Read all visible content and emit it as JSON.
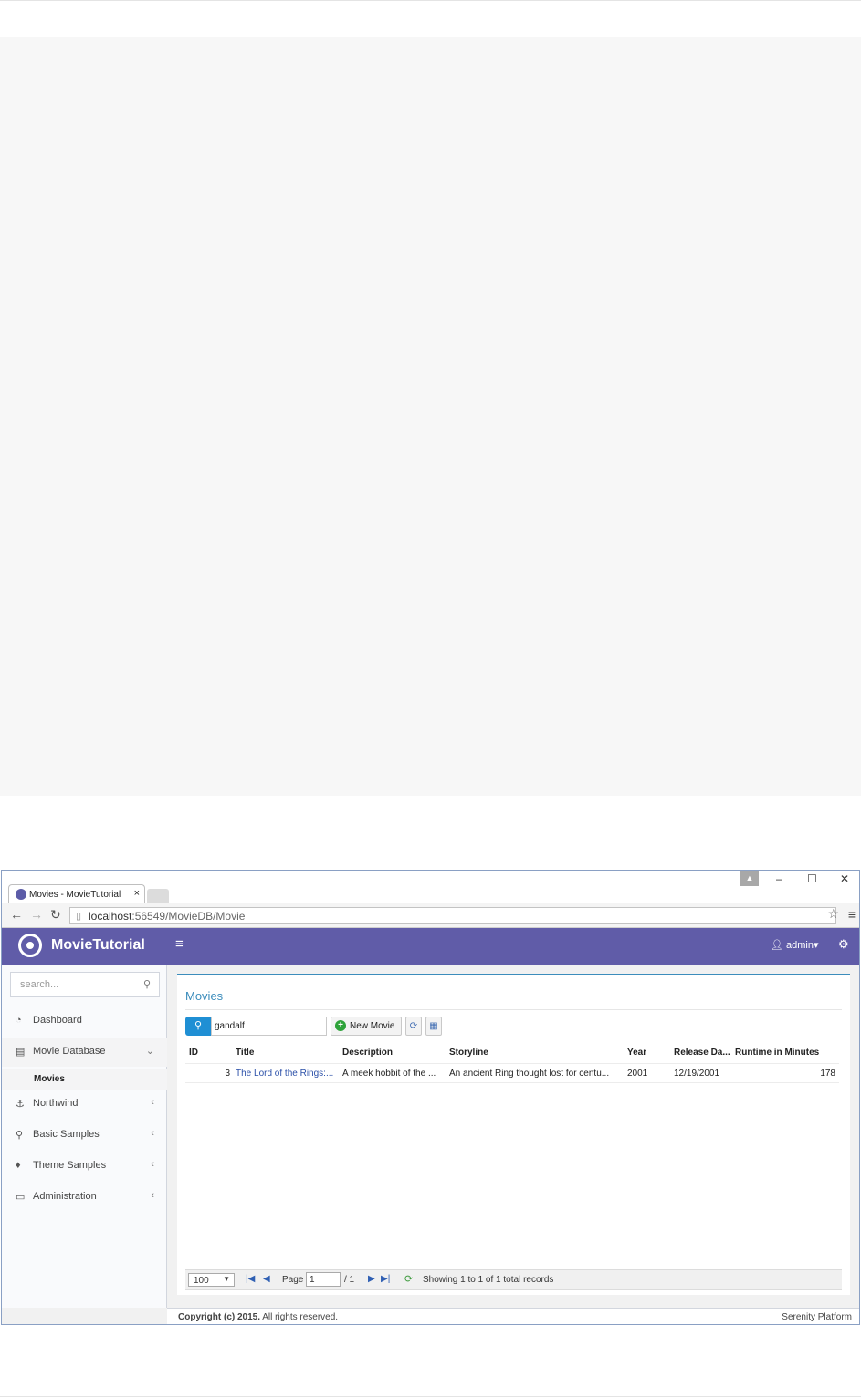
{
  "browser": {
    "tab_title": "Movies - MovieTutorial",
    "tab_close": "×",
    "url_host": "localhost",
    "url_rest": ":56549/MovieDB/Movie",
    "window_controls": [
      "–",
      "☐",
      "✕"
    ]
  },
  "header": {
    "brand": "MovieTutorial",
    "hamburger": "≡",
    "user": "admin",
    "user_caret": "▾"
  },
  "sidebar": {
    "search_placeholder": "search...",
    "items": [
      {
        "label": "Dashboard",
        "icon": "dashboard-icon"
      },
      {
        "label": "Movie Database",
        "icon": "film-icon",
        "chevron": "⌄"
      },
      {
        "label": "Northwind",
        "icon": "anchor-icon",
        "chevron": "‹"
      },
      {
        "label": "Basic Samples",
        "icon": "magic-icon",
        "chevron": "‹"
      },
      {
        "label": "Theme Samples",
        "icon": "diamond-icon",
        "chevron": "‹"
      },
      {
        "label": "Administration",
        "icon": "desktop-icon",
        "chevron": "‹"
      }
    ],
    "sub_item": "Movies"
  },
  "main": {
    "title": "Movies",
    "search_value": "gandalf",
    "new_button": "New Movie",
    "columns": [
      "ID",
      "Title",
      "Description",
      "Storyline",
      "Year",
      "Release Da...",
      "Runtime in Minutes"
    ],
    "rows": [
      {
        "id": "3",
        "title": "The Lord of the Rings:...",
        "description": "A meek hobbit of the ...",
        "storyline": "An ancient Ring thought lost for centu...",
        "year": "2001",
        "release": "12/19/2001",
        "runtime": "178"
      }
    ],
    "pager": {
      "page_size": "100",
      "page_label": "Page",
      "page_value": "1",
      "page_total": "/ 1",
      "status": "Showing 1 to 1 of 1 total records"
    }
  },
  "footer": {
    "copyright_bold": "Copyright (c) 2015.",
    "copyright_rest": " All rights reserved.",
    "platform": "Serenity Platform"
  },
  "colors": {
    "header": "#605ca8",
    "accent": "#3c8dbc",
    "button_blue": "#1f8fd4",
    "add_green": "#2ea33a"
  }
}
